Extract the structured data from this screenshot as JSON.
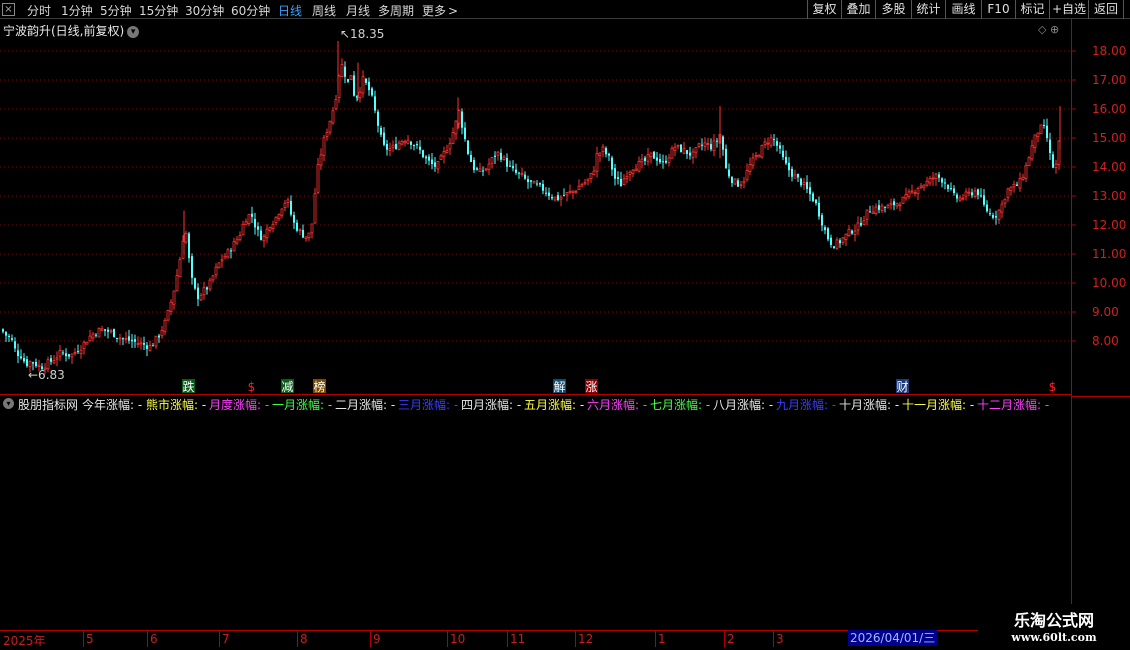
{
  "toolbar": {
    "close_glyph": "×",
    "periods": [
      "分时",
      "1分钟",
      "5分钟",
      "15分钟",
      "30分钟",
      "60分钟",
      "日线",
      "周线",
      "月线",
      "多周期",
      "更多"
    ],
    "more_glyph": ">",
    "active_period": "日线",
    "buttons": [
      "复权",
      "叠加",
      "多股",
      "统计",
      "画线",
      "F10",
      "标记",
      "+自选",
      "返回"
    ]
  },
  "chart": {
    "title": "宁波韵升(日线,前复权)",
    "title_caret": "▾",
    "top_icons": "◇ ⊕",
    "price_ticks": [
      "18.00",
      "17.00",
      "16.00",
      "15.00",
      "14.00",
      "13.00",
      "12.00",
      "11.00",
      "10.00",
      "9.00",
      "8.00"
    ],
    "high_label": "18.35",
    "low_label": "6.83",
    "markers": [
      {
        "text": "跌",
        "bg": "#0a5c1a",
        "fg": "#ffffff"
      },
      {
        "text": "$",
        "bg": "#000000",
        "fg": "#ff2020"
      },
      {
        "text": "减",
        "bg": "#0a5c1a",
        "fg": "#ffffff"
      },
      {
        "text": "榜",
        "bg": "#7a4a00",
        "fg": "#ffffff"
      },
      {
        "text": "解",
        "bg": "#0a4d6e",
        "fg": "#ffffff"
      },
      {
        "text": "涨",
        "bg": "#8a0000",
        "fg": "#ffffff"
      },
      {
        "text": "财",
        "bg": "#1a3a7a",
        "fg": "#ffffff"
      },
      {
        "text": "$",
        "bg": "#000000",
        "fg": "#ff2020"
      }
    ]
  },
  "chart_data": {
    "type": "candlestick",
    "title": "宁波韵升(日线,前复权)",
    "y_range": [
      7.3,
      18.9
    ],
    "y_ticks": [
      8,
      9,
      10,
      11,
      12,
      13,
      14,
      15,
      16,
      17,
      18
    ],
    "marked_high": 18.35,
    "marked_low": 6.83,
    "colors": {
      "up": "#ff3232",
      "down": "#54ffff",
      "grid": "#8a0000"
    },
    "close_path": [
      [
        0,
        8.4
      ],
      [
        5,
        8.2
      ],
      [
        10,
        8.1
      ],
      [
        15,
        7.6
      ],
      [
        20,
        7.5
      ],
      [
        25,
        7.2
      ],
      [
        30,
        7.3
      ],
      [
        40,
        7.1
      ],
      [
        50,
        7.3
      ],
      [
        60,
        7.6
      ],
      [
        70,
        7.5
      ],
      [
        80,
        7.8
      ],
      [
        90,
        8.2
      ],
      [
        100,
        8.4
      ],
      [
        110,
        8.3
      ],
      [
        120,
        8.1
      ],
      [
        130,
        8.0
      ],
      [
        140,
        7.9
      ],
      [
        150,
        7.8
      ],
      [
        158,
        8.2
      ],
      [
        165,
        8.7
      ],
      [
        172,
        9.6
      ],
      [
        178,
        10.6
      ],
      [
        184,
        12.0
      ],
      [
        190,
        10.2
      ],
      [
        196,
        9.5
      ],
      [
        202,
        9.7
      ],
      [
        208,
        9.9
      ],
      [
        214,
        10.4
      ],
      [
        220,
        10.8
      ],
      [
        226,
        11.0
      ],
      [
        232,
        11.3
      ],
      [
        238,
        11.6
      ],
      [
        244,
        12.2
      ],
      [
        250,
        12.4
      ],
      [
        256,
        11.8
      ],
      [
        262,
        11.5
      ],
      [
        268,
        12.0
      ],
      [
        274,
        12.2
      ],
      [
        280,
        12.6
      ],
      [
        286,
        12.9
      ],
      [
        292,
        12.1
      ],
      [
        298,
        11.8
      ],
      [
        304,
        11.6
      ],
      [
        310,
        11.7
      ],
      [
        316,
        13.8
      ],
      [
        322,
        14.8
      ],
      [
        328,
        15.5
      ],
      [
        334,
        16.2
      ],
      [
        338,
        17.2
      ],
      [
        342,
        17.6
      ],
      [
        346,
        16.8
      ],
      [
        350,
        17.2
      ],
      [
        354,
        16.3
      ],
      [
        358,
        16.6
      ],
      [
        362,
        17.0
      ],
      [
        366,
        16.8
      ],
      [
        370,
        16.5
      ],
      [
        376,
        15.6
      ],
      [
        382,
        14.7
      ],
      [
        388,
        14.6
      ],
      [
        394,
        14.7
      ],
      [
        400,
        14.9
      ],
      [
        406,
        15.0
      ],
      [
        412,
        14.8
      ],
      [
        418,
        14.6
      ],
      [
        424,
        14.3
      ],
      [
        430,
        14.1
      ],
      [
        436,
        14.0
      ],
      [
        442,
        14.4
      ],
      [
        448,
        14.8
      ],
      [
        454,
        15.4
      ],
      [
        458,
        15.9
      ],
      [
        462,
        15.3
      ],
      [
        466,
        14.6
      ],
      [
        472,
        14.0
      ],
      [
        478,
        13.8
      ],
      [
        484,
        13.9
      ],
      [
        490,
        14.2
      ],
      [
        496,
        14.5
      ],
      [
        502,
        14.3
      ],
      [
        508,
        14.0
      ],
      [
        514,
        13.8
      ],
      [
        520,
        13.7
      ],
      [
        526,
        13.5
      ],
      [
        532,
        13.4
      ],
      [
        538,
        13.3
      ],
      [
        544,
        13.2
      ],
      [
        550,
        13.0
      ],
      [
        556,
        12.9
      ],
      [
        562,
        13.0
      ],
      [
        568,
        13.1
      ],
      [
        574,
        13.2
      ],
      [
        580,
        13.4
      ],
      [
        586,
        13.5
      ],
      [
        592,
        13.8
      ],
      [
        596,
        14.4
      ],
      [
        602,
        14.6
      ],
      [
        608,
        14.3
      ],
      [
        614,
        13.6
      ],
      [
        620,
        13.4
      ],
      [
        626,
        13.8
      ],
      [
        632,
        14.0
      ],
      [
        638,
        14.1
      ],
      [
        644,
        14.2
      ],
      [
        650,
        14.4
      ],
      [
        656,
        14.3
      ],
      [
        662,
        14.1
      ],
      [
        668,
        14.4
      ],
      [
        674,
        14.7
      ],
      [
        680,
        14.6
      ],
      [
        686,
        14.5
      ],
      [
        692,
        14.4
      ],
      [
        698,
        14.7
      ],
      [
        704,
        14.8
      ],
      [
        710,
        14.7
      ],
      [
        716,
        14.9
      ],
      [
        720,
        15.2
      ],
      [
        724,
        14.0
      ],
      [
        730,
        13.6
      ],
      [
        736,
        13.4
      ],
      [
        742,
        13.5
      ],
      [
        748,
        14.0
      ],
      [
        754,
        14.3
      ],
      [
        760,
        14.6
      ],
      [
        766,
        14.9
      ],
      [
        772,
        15.0
      ],
      [
        778,
        14.6
      ],
      [
        784,
        14.1
      ],
      [
        790,
        13.8
      ],
      [
        796,
        13.6
      ],
      [
        802,
        13.4
      ],
      [
        808,
        13.1
      ],
      [
        814,
        12.8
      ],
      [
        820,
        12.2
      ],
      [
        826,
        11.6
      ],
      [
        832,
        11.3
      ],
      [
        838,
        11.4
      ],
      [
        844,
        11.6
      ],
      [
        850,
        11.8
      ],
      [
        856,
        11.9
      ],
      [
        862,
        12.2
      ],
      [
        868,
        12.5
      ],
      [
        874,
        12.6
      ],
      [
        880,
        12.6
      ],
      [
        886,
        12.6
      ],
      [
        892,
        12.7
      ],
      [
        898,
        12.8
      ],
      [
        904,
        12.9
      ],
      [
        910,
        13.1
      ],
      [
        916,
        13.3
      ],
      [
        922,
        13.4
      ],
      [
        928,
        13.5
      ],
      [
        934,
        13.7
      ],
      [
        940,
        13.6
      ],
      [
        946,
        13.4
      ],
      [
        952,
        13.0
      ],
      [
        958,
        12.9
      ],
      [
        964,
        13.0
      ],
      [
        970,
        13.1
      ],
      [
        976,
        13.2
      ],
      [
        982,
        12.7
      ],
      [
        988,
        12.4
      ],
      [
        994,
        12.3
      ],
      [
        1000,
        12.6
      ],
      [
        1006,
        13.2
      ],
      [
        1012,
        13.3
      ],
      [
        1018,
        13.4
      ],
      [
        1024,
        13.9
      ],
      [
        1030,
        14.6
      ],
      [
        1036,
        15.2
      ],
      [
        1042,
        15.4
      ],
      [
        1046,
        15.0
      ],
      [
        1050,
        14.2
      ],
      [
        1054,
        13.8
      ],
      [
        1058,
        14.8
      ],
      [
        1062,
        15.4
      ]
    ]
  },
  "indicator": {
    "caret": "▾",
    "name": "股朋指标网",
    "items": [
      {
        "label": "今年涨幅:",
        "value": "-",
        "color": "#e6e6e6"
      },
      {
        "label": "熊市涨幅:",
        "value": "-",
        "color": "#ffff40"
      },
      {
        "label": "月度涨幅:",
        "value": "-",
        "color": "#ff40ff"
      },
      {
        "label": "一月涨幅:",
        "value": "-",
        "color": "#40ff40"
      },
      {
        "label": "二月涨幅:",
        "value": "-",
        "color": "#e6e6e6"
      },
      {
        "label": "三月涨幅:",
        "value": "-",
        "color": "#3c3cff"
      },
      {
        "label": "四月涨幅:",
        "value": "-",
        "color": "#e6e6e6"
      },
      {
        "label": "五月涨幅:",
        "value": "-",
        "color": "#ffff40"
      },
      {
        "label": "六月涨幅:",
        "value": "-",
        "color": "#ff40ff"
      },
      {
        "label": "七月涨幅:",
        "value": "-",
        "color": "#40ff40"
      },
      {
        "label": "八月涨幅:",
        "value": "-",
        "color": "#e6e6e6"
      },
      {
        "label": "九月涨幅:",
        "value": "-",
        "color": "#3c3cff"
      },
      {
        "label": "十月涨幅:",
        "value": "-",
        "color": "#e6e6e6"
      },
      {
        "label": "十一月涨幅:",
        "value": "-",
        "color": "#ffff40"
      },
      {
        "label": "十二月涨幅:",
        "value": "-",
        "color": "#ff40ff"
      }
    ]
  },
  "date_axis": {
    "labels": [
      "2025年",
      "5",
      "6",
      "7",
      "8",
      "9",
      "10",
      "11",
      "12",
      "1",
      "2",
      "3"
    ],
    "cursor_date": "2026/04/01/三"
  },
  "brand": {
    "name": "乐淘公式网",
    "url": "www.60lt.com"
  }
}
